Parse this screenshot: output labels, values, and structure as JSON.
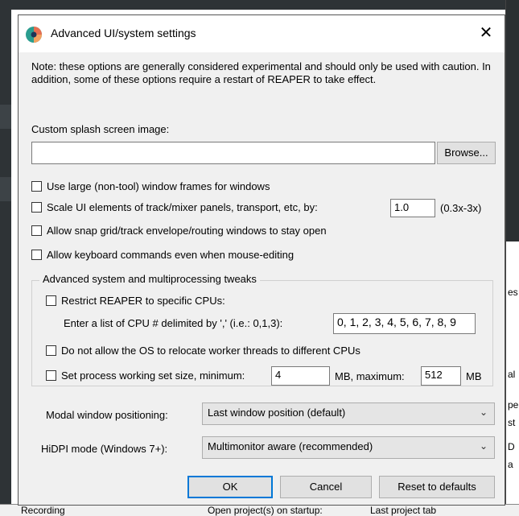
{
  "dialog": {
    "title": "Advanced UI/system settings",
    "close_label": "✕",
    "note": "Note: these options are generally considered experimental and should only be used with caution. In addition, some of these options require a restart of REAPER to take effect.",
    "splash_label": "Custom splash screen image:",
    "splash_value": "",
    "browse_label": "Browse...",
    "options": [
      {
        "label": "Use large (non-tool) window frames for windows",
        "checked": false
      },
      {
        "label": "Scale UI elements of track/mixer panels, transport, etc, by:",
        "checked": false
      },
      {
        "label": "Allow snap grid/track envelope/routing windows to stay open",
        "checked": false
      },
      {
        "label": "Allow keyboard commands even when mouse-editing",
        "checked": false
      }
    ],
    "scale_value": "1.0",
    "scale_range": "(0.3x-3x)",
    "advanced": {
      "title": "Advanced system and multiprocessing tweaks",
      "restrict_label": "Restrict REAPER to specific CPUs:",
      "cpu_list_label": "Enter a list of CPU # delimited by ',' (i.e.: 0,1,3):",
      "cpu_list_value": "0, 1, 2, 3, 4, 5, 6, 7, 8, 9",
      "no_relocate_label": "Do not allow the OS to relocate worker threads to different CPUs",
      "working_set_label": "Set process working set size, minimum:",
      "min_value": "4",
      "mb_max_label": "MB, maximum:",
      "max_value": "512",
      "mb_label": "MB"
    },
    "modal_label": "Modal window positioning:",
    "modal_value": "Last window position (default)",
    "hidpi_label": "HiDPI mode (Windows 7+):",
    "hidpi_value": "Multimonitor aware (recommended)",
    "ok_label": "OK",
    "cancel_label": "Cancel",
    "reset_label": "Reset to defaults"
  },
  "background": {
    "right_fragments": [
      "es",
      "al",
      "pe",
      "st",
      "D",
      "a"
    ],
    "bottom_fragments": [
      "Recording",
      "Open project(s) on startup:",
      "Last project tab"
    ]
  }
}
